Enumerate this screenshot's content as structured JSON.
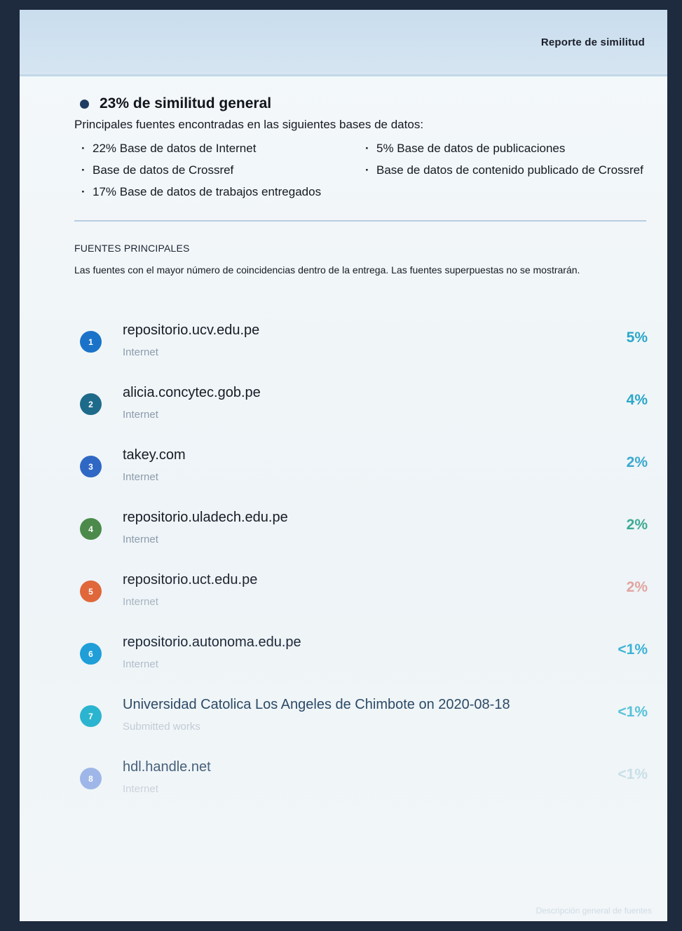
{
  "header": {
    "title": "Reporte de similitud"
  },
  "summary": {
    "overall": "23% de similitud general",
    "intro": "Principales fuentes encontradas en las siguientes bases de datos:",
    "databases": [
      "22% Base de datos de Internet",
      "5% Base de datos de publicaciones",
      "Base de datos de Crossref",
      "Base de datos de contenido publicado de Crossref",
      "17% Base de datos de trabajos entregados"
    ]
  },
  "sources_section": {
    "title": "FUENTES PRINCIPALES",
    "description": "Las fuentes con el mayor número de coincidencias dentro de la entrega. Las fuentes superpuestas no se mostrarán."
  },
  "sources": [
    {
      "num": "1",
      "name": "repositorio.ucv.edu.pe",
      "type": "Internet",
      "percent": "5%",
      "color": "#1a73c8",
      "pct_color": "#2aa7c9",
      "name_color": "#161c26",
      "type_color": "#8c9bab"
    },
    {
      "num": "2",
      "name": "alicia.concytec.gob.pe",
      "type": "Internet",
      "percent": "4%",
      "color": "#1e6a8a",
      "pct_color": "#2aa7c9",
      "name_color": "#161c26",
      "type_color": "#8c9bab"
    },
    {
      "num": "3",
      "name": "takey.com",
      "type": "Internet",
      "percent": "2%",
      "color": "#2f67c4",
      "pct_color": "#3aa9cf",
      "name_color": "#161c26",
      "type_color": "#8c9bab"
    },
    {
      "num": "4",
      "name": "repositorio.uladech.edu.pe",
      "type": "Internet",
      "percent": "2%",
      "color": "#4b8a4b",
      "pct_color": "#3daa94",
      "name_color": "#161c26",
      "type_color": "#8c9bab"
    },
    {
      "num": "5",
      "name": "repositorio.uct.edu.pe",
      "type": "Internet",
      "percent": "2%",
      "color": "#e0673a",
      "pct_color": "#e2a4a0",
      "name_color": "#1e2530",
      "type_color": "#a7b3c0"
    },
    {
      "num": "6",
      "name": "repositorio.autonoma.edu.pe",
      "type": "Internet",
      "percent": "<1%",
      "color": "#1f9ed8",
      "pct_color": "#3cb3d6",
      "name_color": "#1e2838",
      "type_color": "#b0bdca"
    },
    {
      "num": "7",
      "name": "Universidad Catolica Los Angeles de Chimbote on 2020-08-18",
      "type": "Submitted works",
      "percent": "<1%",
      "color": "#2bb4cf",
      "pct_color": "#56c2d9",
      "name_color": "#2c4a66",
      "type_color": "#c2ccd6"
    },
    {
      "num": "8",
      "name": "hdl.handle.net",
      "type": "Internet",
      "percent": "<1%",
      "color": "#9fb6e8",
      "pct_color": "#c8dfe8",
      "name_color": "#47607a",
      "type_color": "#c9d2dc"
    }
  ],
  "footer": {
    "note": "Descripción general de fuentes"
  }
}
